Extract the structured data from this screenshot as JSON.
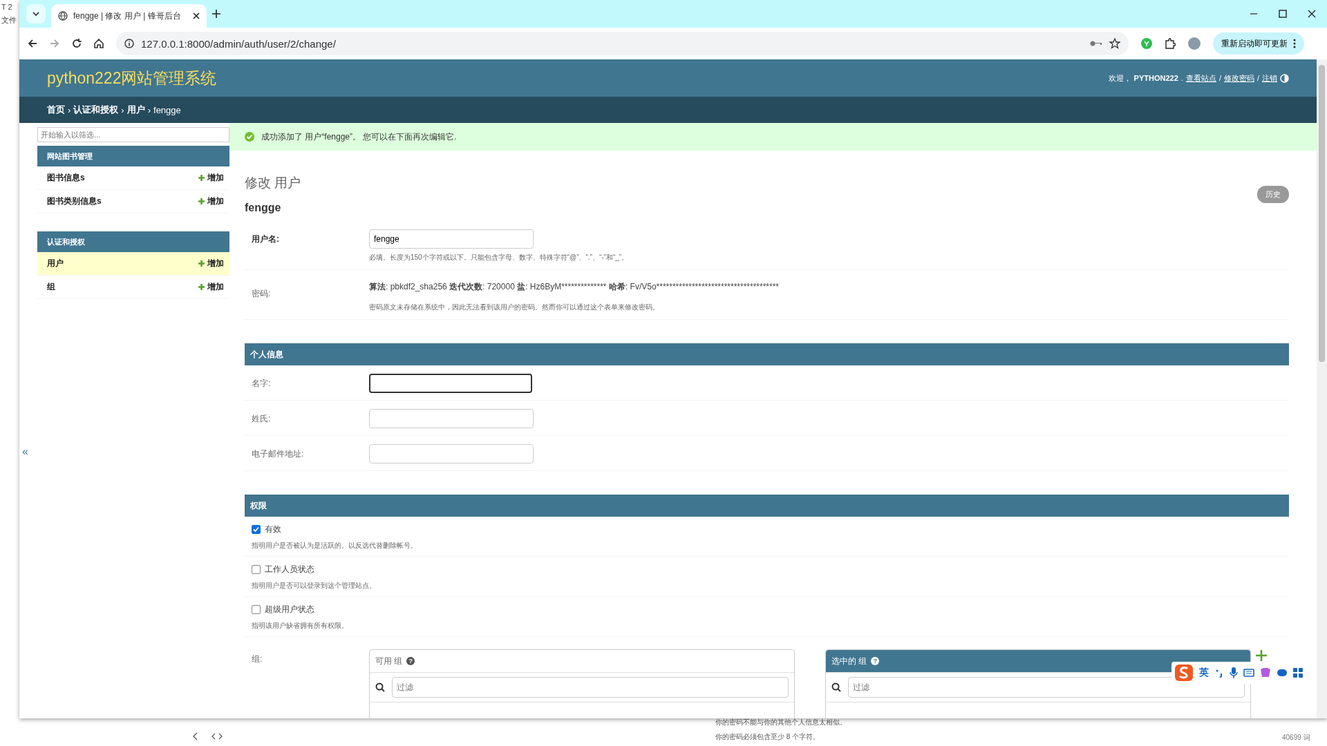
{
  "desktop": {
    "left_texts": [
      "T 2",
      "文件"
    ],
    "bottom_hints": [
      "你的密码不能与你的其他个人信息太相似。",
      "你的密码必须包含至少 8 个字符。"
    ],
    "word_count": "40699 词"
  },
  "browser": {
    "tab": {
      "title": "fengge | 修改 用户 | 锋哥后台"
    },
    "url": "127.0.0.1:8000/admin/auth/user/2/change/",
    "update_button": "重新启动即可更新"
  },
  "site": {
    "title": "python222网站管理系统",
    "welcome": "欢迎，",
    "user": "PYTHON222",
    "user_suffix": ".",
    "links": [
      {
        "text": "查看站点"
      },
      {
        "separator": "/",
        "text": "修改密码"
      },
      {
        "separator": "/",
        "text": "注销"
      }
    ],
    "breadcrumbs": [
      {
        "text": "首页",
        "separator": "›"
      },
      {
        "text": "认证和授权",
        "separator": "›"
      },
      {
        "text": "用户",
        "separator": "›"
      },
      {
        "text": "fengge"
      }
    ]
  },
  "sidebar": {
    "filter_placeholder": "开始输入以筛选...",
    "collapse": "«",
    "apps": [
      {
        "name": "网站图书管理",
        "models": [
          {
            "name": "图书信息s",
            "add": "增加",
            "selected": false
          },
          {
            "name": "图书类别信息s",
            "add": "增加",
            "selected": false
          }
        ]
      },
      {
        "name": "认证和授权",
        "models": [
          {
            "name": "用户",
            "add": "增加",
            "selected": true
          },
          {
            "name": "组",
            "add": "增加",
            "selected": false
          }
        ]
      }
    ]
  },
  "message": "成功添加了 用户“fengge”。 您可以在下面再次编辑它.",
  "content": {
    "title": "修改 用户",
    "object": "fengge",
    "history_button": "历史",
    "username": {
      "label": "用户名:",
      "value": "fengge",
      "help": "必填。长度为150个字符或以下。只能包含字母、数字、特殊字符“@”、“.”、“-”和“_”。"
    },
    "password": {
      "label": "密码:",
      "info": [
        {
          "key": "算法",
          "value": ": pbkdf2_sha256"
        },
        {
          "key": "迭代次数",
          "value": ": 720000"
        },
        {
          "key": "盐",
          "value": ": Hz6ByM**************"
        },
        {
          "key": "哈希",
          "value": ": Fv/V5o**************************************"
        }
      ],
      "help": "密码原文未存储在系统中，因此无法看到该用户的密码。然而你可以通过这个表单来修改密码。"
    },
    "personal": {
      "title": "个人信息",
      "fields": [
        {
          "label": "名字:",
          "focused": true
        },
        {
          "label": "姓氏:",
          "focused": false
        },
        {
          "label": "电子邮件地址:",
          "focused": false
        }
      ]
    },
    "permissions": {
      "title": "权限",
      "checks": [
        {
          "label": "有效",
          "checked": true,
          "help": "指明用户是否被认为是活跃的。以反选代替删除帐号。"
        },
        {
          "label": "工作人员状态",
          "checked": false,
          "help": "指明用户是否可以登录到这个管理站点。"
        },
        {
          "label": "超级用户状态",
          "checked": false,
          "help": "指明该用户缺省拥有所有权限。"
        }
      ],
      "groups": {
        "label": "组:",
        "available": {
          "title": "可用 组",
          "help": "?",
          "filter_placeholder": "过滤"
        },
        "chosen": {
          "title": "选中的 组",
          "help": "?",
          "filter_placeholder": "过滤"
        }
      }
    }
  },
  "ime": {
    "mode": "英"
  }
}
